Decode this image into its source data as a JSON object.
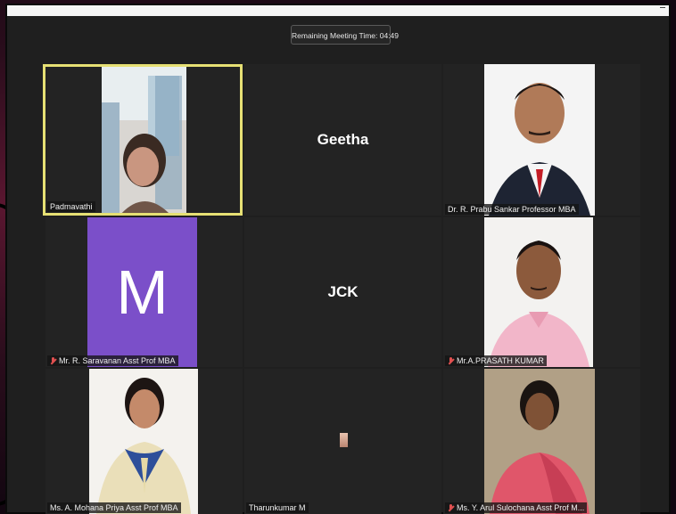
{
  "timer": {
    "label": "Remaining Meeting Time: 04:49"
  },
  "participants": [
    {
      "name": "Padmavathi",
      "type": "video",
      "active": true,
      "muted": false
    },
    {
      "name": "Geetha",
      "type": "name-only"
    },
    {
      "name": "Dr. R. Prabu Sankar Professor MBA",
      "type": "photo",
      "muted": false
    },
    {
      "name": "Mr. R. Saravanan Asst Prof MBA",
      "type": "avatar",
      "initial": "M",
      "muted": true
    },
    {
      "name": "JCK",
      "type": "name-only"
    },
    {
      "name": "Mr.A.PRASATH KUMAR",
      "type": "photo",
      "muted": true
    },
    {
      "name": "Ms. A. Mohana Priya Asst Prof MBA",
      "type": "photo",
      "muted": false
    },
    {
      "name": "Tharunkumar M",
      "type": "video-small",
      "muted": false
    },
    {
      "name": "Ms. Y. Arul Sulochana Asst Prof M...",
      "type": "photo",
      "muted": true
    }
  ],
  "colors": {
    "active_border": "#e6e074",
    "avatar_bg": "#7b4fc9",
    "tile_bg": "#232323",
    "muted_icon": "#e05050"
  },
  "icons": [
    "mic-muted-icon"
  ]
}
